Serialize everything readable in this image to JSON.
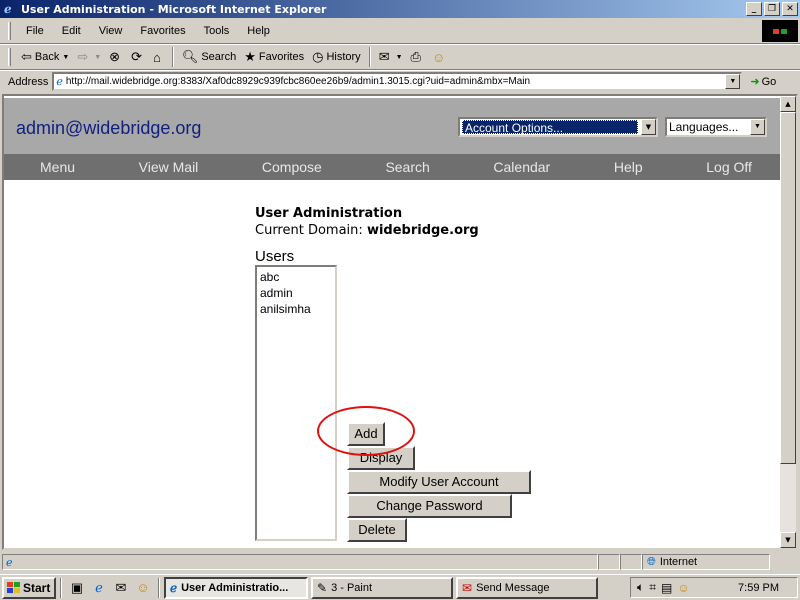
{
  "window": {
    "title": "User Administration - Microsoft Internet Explorer",
    "controls": [
      "_",
      "❐",
      "✕"
    ]
  },
  "menubar": [
    "File",
    "Edit",
    "View",
    "Favorites",
    "Tools",
    "Help"
  ],
  "toolbar": {
    "back": "Back",
    "search": "Search",
    "favorites": "Favorites",
    "history": "History"
  },
  "address": {
    "label": "Address",
    "url": "http://mail.widebridge.org:8383/Xaf0dc8929c939fcbc860ee26b9/admin1.3015.cgi?uid=admin&mbx=Main",
    "go": "Go"
  },
  "page": {
    "account": "admin@widebridge.org",
    "account_options": "Account Options...",
    "languages": "Languages...",
    "nav": [
      "Menu",
      "View Mail",
      "Compose",
      "Search",
      "Calendar",
      "Help",
      "Log Off"
    ],
    "title": "User Administration",
    "domain_label": "Current Domain:",
    "domain_value": "widebridge.org",
    "users_label": "Users",
    "users": [
      "abc",
      "admin",
      "anilsimha"
    ],
    "buttons": {
      "add": "Add",
      "display": "Display",
      "modify": "Modify User Account",
      "change_password": "Change Password",
      "delete": "Delete"
    },
    "highlight_color": "#e01010"
  },
  "status": {
    "zone": "Internet"
  },
  "taskbar": {
    "start": "Start",
    "tasks": [
      "User Administratio...",
      "3 - Paint",
      "Send Message"
    ],
    "clock": "7:59 PM"
  }
}
